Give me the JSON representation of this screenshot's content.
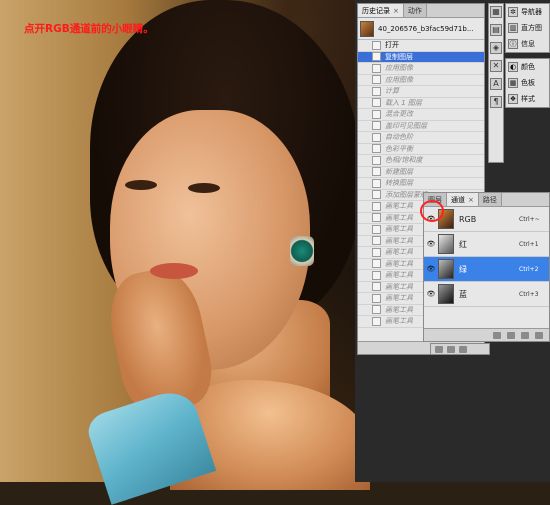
{
  "annotation": "点开RGB通道前的小眼睛。",
  "history": {
    "tabs": [
      {
        "label": "历史记录",
        "active": true
      },
      {
        "label": "动作",
        "active": false
      }
    ],
    "snapshot_name": "40_206576_b3fac59d71b...",
    "items": [
      {
        "label": "打开",
        "state": "plain"
      },
      {
        "label": "复制图层",
        "state": "active"
      },
      {
        "label": "应用图像",
        "state": "disabled"
      },
      {
        "label": "应用图像",
        "state": "disabled"
      },
      {
        "label": "计算",
        "state": "disabled"
      },
      {
        "label": "载入 1 图层",
        "state": "disabled"
      },
      {
        "label": "混合更改",
        "state": "disabled"
      },
      {
        "label": "盖印可见图层",
        "state": "disabled"
      },
      {
        "label": "自动色阶",
        "state": "disabled"
      },
      {
        "label": "色彩平衡",
        "state": "disabled"
      },
      {
        "label": "色相/饱和度",
        "state": "disabled"
      },
      {
        "label": "新建图层",
        "state": "disabled"
      },
      {
        "label": "转换图层",
        "state": "disabled"
      },
      {
        "label": "添加图层蒙版",
        "state": "disabled"
      },
      {
        "label": "画笔工具",
        "state": "disabled"
      },
      {
        "label": "画笔工具",
        "state": "disabled"
      },
      {
        "label": "画笔工具",
        "state": "disabled"
      },
      {
        "label": "画笔工具",
        "state": "disabled"
      },
      {
        "label": "画笔工具",
        "state": "disabled"
      },
      {
        "label": "画笔工具",
        "state": "disabled"
      },
      {
        "label": "画笔工具",
        "state": "disabled"
      },
      {
        "label": "画笔工具",
        "state": "disabled"
      },
      {
        "label": "画笔工具",
        "state": "disabled"
      },
      {
        "label": "画笔工具",
        "state": "disabled"
      },
      {
        "label": "画笔工具",
        "state": "disabled"
      }
    ]
  },
  "right_panels": {
    "group1": [
      {
        "icon": "navigator-icon",
        "label": "导航器"
      },
      {
        "icon": "histogram-icon",
        "label": "直方图"
      },
      {
        "icon": "info-icon",
        "label": "信息"
      }
    ],
    "group2": [
      {
        "icon": "color-icon",
        "label": "颜色"
      },
      {
        "icon": "swatches-icon",
        "label": "色板"
      },
      {
        "icon": "styles-icon",
        "label": "样式"
      }
    ]
  },
  "channels": {
    "tabs": [
      {
        "label": "图层",
        "active": false
      },
      {
        "label": "通道",
        "active": true
      },
      {
        "label": "路径",
        "active": false
      }
    ],
    "rows": [
      {
        "name": "RGB",
        "shortcut": "Ctrl+~",
        "active": false,
        "thumb": "linear-gradient(135deg,#d78a3e,#3a2010)"
      },
      {
        "name": "红",
        "shortcut": "Ctrl+1",
        "active": false,
        "thumb": "linear-gradient(135deg,#e6e6e6,#555)"
      },
      {
        "name": "绿",
        "shortcut": "Ctrl+2",
        "active": true,
        "thumb": "linear-gradient(135deg,#bdbdbd,#222)"
      },
      {
        "name": "蓝",
        "shortcut": "Ctrl+3",
        "active": false,
        "thumb": "linear-gradient(135deg,#999,#111)"
      }
    ]
  },
  "colors": {
    "annotation": "#ff1a1a",
    "selection": "#3b6fd8",
    "channel_active": "#3b82e8",
    "highlight_circle": "#ff2020"
  }
}
